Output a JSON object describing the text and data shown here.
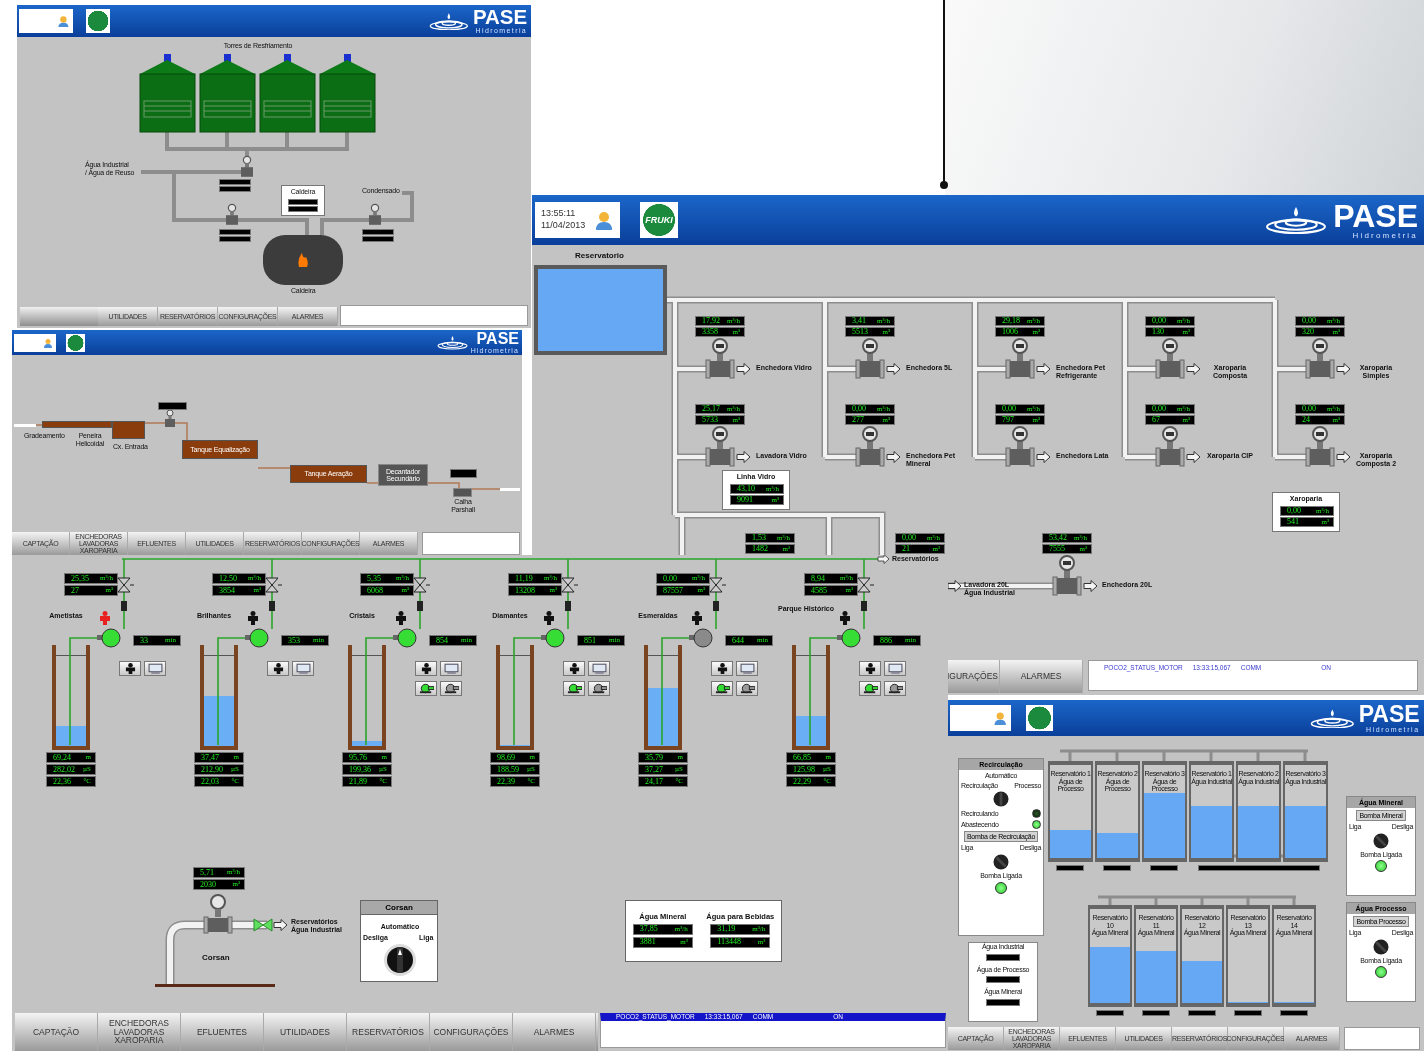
{
  "utilities": {
    "header": {
      "logo": "PASE",
      "logo_subtitle": "Hidrometria"
    },
    "title": "Torres de Resfriamento",
    "inlet_lines": [
      "Água Industrial",
      "/ Água de Reuso"
    ],
    "boiler_box": "Caldeira",
    "condensate": "Condensado",
    "boiler": "Caldeira",
    "tabs": [
      {
        "label": "UTILIDADES"
      },
      {
        "label": "RESERVATÓRIOS"
      },
      {
        "label": "CONFIGURAÇÕES"
      },
      {
        "label": "ALARMES"
      }
    ]
  },
  "effluents": {
    "header": {
      "logo": "PASE",
      "logo_subtitle": "Hidrometria"
    },
    "units": [
      {
        "label": "Gradeamento"
      },
      {
        "label": "Peneira Helicoidal"
      },
      {
        "label": "Cx. Entrada"
      },
      {
        "label": "Tanque Equalização"
      },
      {
        "label": "Tanque Aeração"
      },
      {
        "label": "Decantador Secundário"
      },
      {
        "label": "Calha Parshall"
      }
    ],
    "tabs": [
      {
        "label": "CAPTAÇÃO"
      },
      {
        "label": "ENCHEDORAS LAVADORAS XAROPARIA"
      },
      {
        "label": "EFLUENTES"
      },
      {
        "label": "UTILIDADES"
      },
      {
        "label": "RESERVATÓRIOS"
      },
      {
        "label": "CONFIGURAÇÕES"
      },
      {
        "label": "ALARMES"
      }
    ]
  },
  "filling": {
    "header": {
      "time": "13:55:11",
      "date": "11/04/2013",
      "brand": "FRUKI",
      "logo": "PASE",
      "logo_subtitle": "Hidrometria"
    },
    "reservoir": "Reservatorio",
    "meters": [
      {
        "label": "Enchedora Vidro",
        "readings": [
          {
            "v": "17,92",
            "u": "m³/h"
          },
          {
            "v": "3358",
            "u": "m³"
          }
        ]
      },
      {
        "label": "Enchedora 5L",
        "readings": [
          {
            "v": "3,41",
            "u": "m³/h"
          },
          {
            "v": "5513",
            "u": "m³"
          }
        ]
      },
      {
        "label": "Enchedora Pet Refrigerante",
        "readings": [
          {
            "v": "29,18",
            "u": "m³/h"
          },
          {
            "v": "1006",
            "u": "m³"
          }
        ]
      },
      {
        "label": "Xaroparia Composta",
        "readings": [
          {
            "v": "0,00",
            "u": "m³/h"
          },
          {
            "v": "130",
            "u": "m³"
          }
        ]
      },
      {
        "label": "Xaroparia Simples",
        "readings": [
          {
            "v": "0,00",
            "u": "m³/h"
          },
          {
            "v": "320",
            "u": "m³"
          }
        ]
      },
      {
        "label": "Lavadora Vidro",
        "readings": [
          {
            "v": "25,17",
            "u": "m³/h"
          },
          {
            "v": "5733",
            "u": "m³"
          }
        ]
      },
      {
        "label": "Enchedora Pet Mineral",
        "readings": [
          {
            "v": "0,00",
            "u": "m³/h"
          },
          {
            "v": "277",
            "u": "m³"
          }
        ]
      },
      {
        "label": "Enchedora Lata",
        "readings": [
          {
            "v": "0,00",
            "u": "m³/h"
          },
          {
            "v": "797",
            "u": "m³"
          }
        ]
      },
      {
        "label": "Xaroparia CIP",
        "readings": [
          {
            "v": "0,00",
            "u": "m³/h"
          },
          {
            "v": "67",
            "u": "m³"
          }
        ]
      },
      {
        "label": "Xaroparia Composta 2",
        "readings": [
          {
            "v": "0,00",
            "u": "m³/h"
          },
          {
            "v": "24",
            "u": "m³"
          }
        ]
      },
      {
        "readings": [
          {
            "v": "1,53",
            "u": "m³/h"
          },
          {
            "v": "1482",
            "u": "m³"
          }
        ]
      },
      {
        "readings": [
          {
            "v": "0,00",
            "u": "m³/h"
          },
          {
            "v": "21",
            "u": "m³"
          }
        ]
      },
      {
        "label": "Enchedora 20L",
        "readings": [
          {
            "v": "53,42",
            "u": "m³/h"
          },
          {
            "v": "7555",
            "u": "m³"
          }
        ]
      }
    ],
    "totals": [
      {
        "title": "Linha Vidro",
        "readings": [
          {
            "v": "43,10",
            "u": "m³/h"
          },
          {
            "v": "9091",
            "u": "m³"
          }
        ]
      },
      {
        "title": "Xaroparia",
        "readings": [
          {
            "v": "0,00",
            "u": "m³/h"
          },
          {
            "v": "541",
            "u": "m³"
          }
        ]
      }
    ],
    "inlet_lines": [
      "Lavadora 20L",
      "Água Industrial"
    ],
    "tabs": [
      {
        "label": "IGURAÇÕES"
      },
      {
        "label": "ALARMES"
      }
    ],
    "status": {
      "tag": "POCO2_STATUS_MOTOR",
      "time": "13:33:15,067",
      "type": "COMM",
      "value": "ON"
    }
  },
  "wells": {
    "outlet": "Reservatórios",
    "list": [
      {
        "name": "Ametistas",
        "kind": "basic",
        "alarm": true,
        "pump_on": true,
        "level": 0.2,
        "readings": [
          {
            "v": "25,35",
            "u": "m³/h"
          },
          {
            "v": "27",
            "u": "m³"
          }
        ],
        "runtime": {
          "v": "33",
          "u": "min"
        },
        "measurements": [
          {
            "v": "69,24",
            "u": "m"
          },
          {
            "v": "282,02",
            "u": "µS"
          },
          {
            "v": "22,36",
            "u": "°C"
          }
        ]
      },
      {
        "name": "Brilhantes",
        "kind": "basic",
        "alarm": false,
        "pump_on": true,
        "level": 0.5,
        "readings": [
          {
            "v": "12,50",
            "u": "m³/h"
          },
          {
            "v": "3854",
            "u": "m³"
          }
        ],
        "runtime": {
          "v": "353",
          "u": "min"
        },
        "measurements": [
          {
            "v": "37,47",
            "u": "m"
          },
          {
            "v": "212,90",
            "u": "µS"
          },
          {
            "v": "22,03",
            "u": "°C"
          }
        ]
      },
      {
        "name": "Cristais",
        "kind": "full",
        "alarm": false,
        "pump_on": true,
        "level": 0.05,
        "readings": [
          {
            "v": "5,35",
            "u": "m³/h"
          },
          {
            "v": "6068",
            "u": "m³"
          }
        ],
        "runtime": {
          "v": "854",
          "u": "min"
        },
        "measurements": [
          {
            "v": "95,76",
            "u": "m"
          },
          {
            "v": "199,36",
            "u": "µS"
          },
          {
            "v": "21,89",
            "u": "°C"
          }
        ]
      },
      {
        "name": "Diamantes",
        "kind": "full",
        "alarm": false,
        "pump_on": true,
        "level": 0.0,
        "readings": [
          {
            "v": "11,19",
            "u": "m³/h"
          },
          {
            "v": "13208",
            "u": "m³"
          }
        ],
        "runtime": {
          "v": "851",
          "u": "min"
        },
        "measurements": [
          {
            "v": "98,69",
            "u": "m"
          },
          {
            "v": "188,59",
            "u": "µS"
          },
          {
            "v": "22,39",
            "u": "°C"
          }
        ]
      },
      {
        "name": "Esmeraldas",
        "kind": "full",
        "alarm": false,
        "pump_on": false,
        "level": 0.57,
        "readings": [
          {
            "v": "0,00",
            "u": "m³/h"
          },
          {
            "v": "87557",
            "u": "m³"
          }
        ],
        "runtime": {
          "v": "644",
          "u": "min"
        },
        "measurements": [
          {
            "v": "35,79",
            "u": "m"
          },
          {
            "v": "37,27",
            "u": "µS"
          },
          {
            "v": "24,17",
            "u": "°C"
          }
        ]
      },
      {
        "name": "Parque Histórico",
        "kind": "full",
        "alarm": false,
        "pump_on": true,
        "level": 0.3,
        "readings": [
          {
            "v": "8,94",
            "u": "m³/h"
          },
          {
            "v": "4585",
            "u": "m³"
          }
        ],
        "runtime": {
          "v": "886",
          "u": "min"
        },
        "measurements": [
          {
            "v": "66,85",
            "u": "m"
          },
          {
            "v": "125,98",
            "u": "µS"
          },
          {
            "v": "22,29",
            "u": "°C"
          }
        ]
      }
    ],
    "corsan": {
      "label": "Corsan",
      "outlet_lines": [
        "Reservatórios",
        "Água Industrial"
      ],
      "readings": [
        {
          "v": "5,71",
          "u": "m³/h"
        },
        {
          "v": "2030",
          "u": "m³"
        }
      ]
    },
    "corsan_panel": {
      "title": "Corsan",
      "mode": "Automático",
      "off": "Desliga",
      "on": "Liga"
    },
    "summary": [
      {
        "title": "Água Mineral",
        "readings": [
          {
            "v": "37,85",
            "u": "m³/h"
          },
          {
            "v": "3881",
            "u": "m³"
          }
        ]
      },
      {
        "title": "Água para Bebidas",
        "readings": [
          {
            "v": "31,19",
            "u": "m³/h"
          },
          {
            "v": "113448",
            "u": "m³"
          }
        ]
      }
    ],
    "tabs": [
      {
        "label": "CAPTAÇÃO"
      },
      {
        "label": "ENCHEDORAS LAVADORAS XAROPARIA"
      },
      {
        "label": "EFLUENTES"
      },
      {
        "label": "UTILIDADES"
      },
      {
        "label": "RESERVATÓRIOS"
      },
      {
        "label": "CONFIGURAÇÕES"
      },
      {
        "label": "ALARMES"
      }
    ],
    "status": {
      "tag": "POCO2_STATUS_MOTOR",
      "time": "13:33:15,067",
      "type": "COMM",
      "value": "ON"
    }
  },
  "reservoirs": {
    "header": {
      "logo": "PASE",
      "logo_subtitle": "Hidrometria"
    },
    "recirculation": {
      "title": "Recirculação",
      "mode": "Automático",
      "left": "Recirculação",
      "right": "Processo",
      "lamps": [
        {
          "label": "Recirculando",
          "on": false
        },
        {
          "label": "Abastecendo",
          "on": true
        }
      ],
      "pump_button": "Bomba de Recirculação",
      "switch_left": "Liga",
      "switch_right": "Desliga",
      "pump_lamp": {
        "label": "Bomba Ligada",
        "on": true
      }
    },
    "top_tanks": [
      {
        "name": "Reservatório 1",
        "sub": "Água de Processo",
        "level": 0.3
      },
      {
        "name": "Reservatório 2",
        "sub": "Água de Processo",
        "level": 0.27
      },
      {
        "name": "Reservatório 3",
        "sub": "Água de Processo",
        "level": 0.7
      },
      {
        "name": "Reservatório 1",
        "sub": "Água Industrial",
        "level": 0.56
      },
      {
        "name": "Reservatório 2",
        "sub": "Água Industrial",
        "level": 0.56
      },
      {
        "name": "Reservatório 3",
        "sub": "Água Industrial",
        "level": 0.56
      }
    ],
    "bottom_tanks": [
      {
        "name": "Reservatório 10",
        "sub": "Água Mineral",
        "level": 0.6
      },
      {
        "name": "Reservatório 11",
        "sub": "Água Mineral",
        "level": 0.55
      },
      {
        "name": "Reservatório 12",
        "sub": "Água Mineral",
        "level": 0.45
      },
      {
        "name": "Reservatório 13",
        "sub": "Água Mineral",
        "level": 0.0
      },
      {
        "name": "Reservatório 14",
        "sub": "Água Mineral",
        "level": 0.0
      }
    ],
    "pump_panels": [
      {
        "title": "Água Mineral",
        "button": "Bomba Mineral",
        "switch_left": "Liga",
        "switch_right": "Desliga",
        "lamp": "Bomba Ligada",
        "on": true
      },
      {
        "title": "Água Processo",
        "button": "Bomba Processo",
        "switch_left": "Liga",
        "switch_right": "Desliga",
        "lamp": "Bomba Ligada",
        "on": true
      }
    ],
    "totals_labels": [
      "Água Industrial",
      "Água de Processo",
      "Água Mineral"
    ],
    "tabs": [
      {
        "label": "CAPTAÇÃO"
      },
      {
        "label": "ENCHEDORAS LAVADORAS XAROPARIA"
      },
      {
        "label": "EFLUENTES"
      },
      {
        "label": "UTILIDADES"
      },
      {
        "label": "RESERVATÓRIOS"
      },
      {
        "label": "CONFIGURAÇÕES"
      },
      {
        "label": "ALARMES"
      }
    ]
  }
}
